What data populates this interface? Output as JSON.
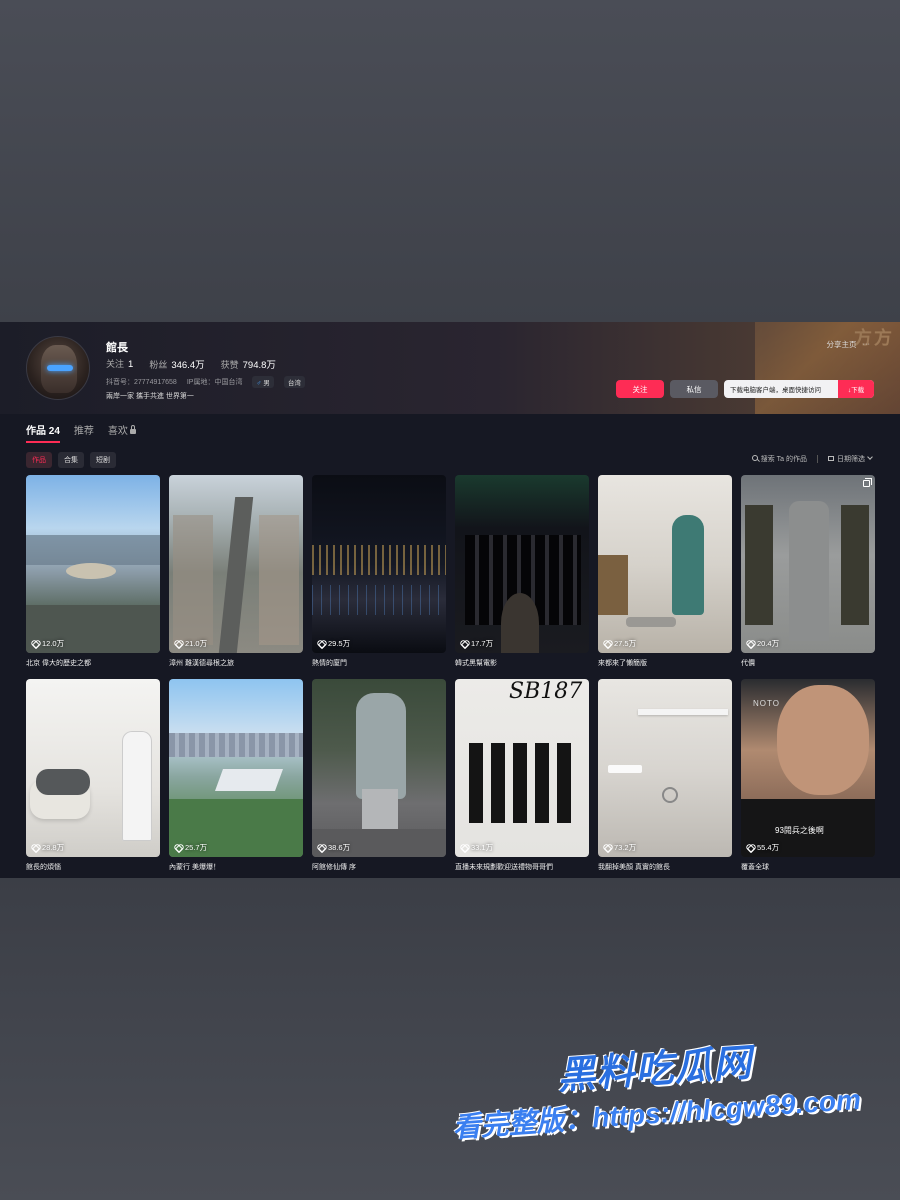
{
  "colors": {
    "accent": "#fe2c55",
    "page_bg": "#161823"
  },
  "profile": {
    "name": "館長",
    "following_label": "关注",
    "following_value": "1",
    "followers_label": "粉丝",
    "followers_value": "346.4万",
    "likes_label": "获赞",
    "likes_value": "794.8万",
    "douyin_id": "抖音号：27774917658",
    "ip": "IP属地：中国台湾",
    "gender_tag": "男",
    "region_tag": "台湾",
    "signature": "兩岸一家 攜手共進 世界第一"
  },
  "header": {
    "share_label": "分享主页",
    "more_label": "···",
    "follow_button": "关注",
    "message_button": "私信",
    "download_text": "下载电脑客户端，桌面快捷访问",
    "download_button": "↓下载",
    "deco_text": "方方"
  },
  "tabs": [
    {
      "label": "作品 24"
    },
    {
      "label": "推荐"
    },
    {
      "label": "喜欢"
    }
  ],
  "subtabs": [
    {
      "label": "作品"
    },
    {
      "label": "合集"
    },
    {
      "label": "短剧"
    }
  ],
  "tools": {
    "search_label": "搜索 Ta 的作品",
    "filter_label": "日期筛选"
  },
  "videos": [
    {
      "likes": "12.0万",
      "caption": "北京 偉大的歷史之都"
    },
    {
      "likes": "21.0万",
      "caption": "漳州 難漢德尋根之旅"
    },
    {
      "likes": "29.5万",
      "caption": "熱情的廈門"
    },
    {
      "likes": "17.7万",
      "caption": "韓式黑幫電影"
    },
    {
      "likes": "27.5万",
      "caption": "來都來了懶簡版"
    },
    {
      "likes": "20.4万",
      "caption": "代價"
    },
    {
      "likes": "28.8万",
      "caption": "館長的煩惱"
    },
    {
      "likes": "25.7万",
      "caption": "內蒙行 美爆爆！"
    },
    {
      "likes": "38.6万",
      "caption": "阿館修仙傳 序"
    },
    {
      "likes": "33.1万",
      "caption": "直播未來規劃歡迎送禮物哥哥們"
    },
    {
      "likes": "73.2万",
      "caption": "我翻掉美顏 真實的館長"
    },
    {
      "likes": "55.4万",
      "caption": "覆蓋全球"
    }
  ],
  "thumb_text": {
    "sb187": "SB187",
    "notor": "NOTO",
    "caption93": "93閱兵之後啊"
  },
  "watermark": {
    "line1": "黑料吃瓜网",
    "line2": "看完整版：https://hlcgw89.com"
  }
}
